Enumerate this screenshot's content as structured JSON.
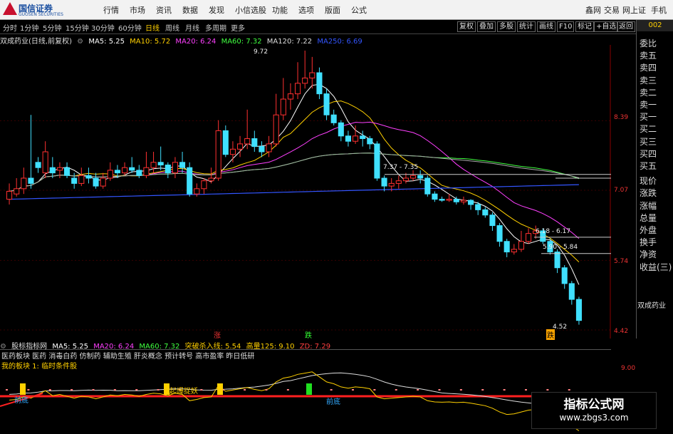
{
  "app": {
    "logo_text": "国信证券",
    "logo_sub": "GUOSEN SECURITIES",
    "menu": [
      "行情",
      "市场",
      "资讯",
      "数据",
      "发现",
      "小信选股",
      "功能",
      "选项",
      "版面",
      "公式"
    ],
    "menu_right": [
      "鑫网",
      "交易",
      "网上证",
      "手机"
    ]
  },
  "periods": [
    "分时",
    "1分钟",
    "5分钟",
    "15分钟",
    "30分钟",
    "60分钟",
    "日线",
    "周线",
    "月线",
    "多周期",
    "更多"
  ],
  "active_period": "日线",
  "toolbar_right": [
    "复权",
    "叠加",
    "多股",
    "统计",
    "画线",
    "F10",
    "标记",
    "+自选",
    "返回"
  ],
  "side_code": "002",
  "indicator_line": {
    "name": "双成药业(日线,前复权)",
    "ma5": "MA5: 5.25",
    "ma10": "MA10: 5.72",
    "ma20": "MA20: 6.24",
    "ma60": "MA60: 7.32",
    "ma120": "MA120: 7.22",
    "ma250": "MA250: 6.69"
  },
  "price_labels": [
    "8.39",
    "7.07",
    "5.74",
    "4.42"
  ],
  "annotations": {
    "high": "9.72",
    "range1": "7.37 - 7.35",
    "range2": "6.18 - 6.17",
    "range3": "5.90 - 5.84",
    "low": "4.52"
  },
  "markers": {
    "up": "涨",
    "down": "跌",
    "low_tag": "跌"
  },
  "side_panel": [
    "委比",
    "卖五",
    "卖四",
    "卖三",
    "卖二",
    "卖一",
    "买一",
    "买二",
    "买三",
    "买四",
    "买五",
    "现价",
    "涨跌",
    "涨幅",
    "总量",
    "外盘",
    "换手",
    "净资",
    "收益(三)"
  ],
  "stock_name": "双成药业",
  "lower_indicator": {
    "name": "股标指标网",
    "ma5": "MA5: 5.25",
    "ma20": "MA20: 6.24",
    "ma60": "MA60: 7.32",
    "break": "突破杀入线: 5.54",
    "vol": "高量125: 9.10",
    "zd": "ZD: 7.29"
  },
  "concept_line": "医药板块 医药 消毒白药 仿制药 辅助生殖 肝炎概念 预计转号 高市盈率 昨日低研",
  "concept_line2": "我的板块 1: 临时条件股",
  "lower_scale": "9.00",
  "lower_marks": {
    "bottom_left": "前底",
    "start": "起爆捉妖",
    "bottom_right": "前底"
  },
  "watermark": {
    "title": "指标公式网",
    "url": "www.zbgs3.com"
  },
  "chart_data": {
    "type": "candlestick",
    "title": "双成药业(日线,前复权)",
    "ylim": [
      4.42,
      9.72
    ],
    "y_ticks": [
      8.39,
      7.07,
      5.74,
      4.42
    ],
    "candles": [
      {
        "o": 6.9,
        "c": 7.05,
        "h": 7.2,
        "l": 6.8
      },
      {
        "o": 7.0,
        "c": 7.1,
        "h": 7.3,
        "l": 6.95
      },
      {
        "o": 7.1,
        "c": 7.3,
        "h": 7.5,
        "l": 7.0
      },
      {
        "o": 7.3,
        "c": 7.2,
        "h": 8.5,
        "l": 7.1
      },
      {
        "o": 7.6,
        "c": 7.5,
        "h": 7.7,
        "l": 7.4
      },
      {
        "o": 7.4,
        "c": 7.8,
        "h": 8.0,
        "l": 7.3
      },
      {
        "o": 7.5,
        "c": 7.4,
        "h": 7.7,
        "l": 7.3
      },
      {
        "o": 7.45,
        "c": 7.5,
        "h": 7.6,
        "l": 7.3
      },
      {
        "o": 7.5,
        "c": 7.35,
        "h": 7.6,
        "l": 7.3
      },
      {
        "o": 7.3,
        "c": 7.2,
        "h": 7.4,
        "l": 7.1
      },
      {
        "o": 7.2,
        "c": 7.35,
        "h": 7.5,
        "l": 7.15
      },
      {
        "o": 7.35,
        "c": 7.3,
        "h": 7.5,
        "l": 7.2
      },
      {
        "o": 7.3,
        "c": 7.15,
        "h": 7.4,
        "l": 7.1
      },
      {
        "o": 7.15,
        "c": 7.3,
        "h": 7.4,
        "l": 7.1
      },
      {
        "o": 7.3,
        "c": 7.45,
        "h": 7.6,
        "l": 7.25
      },
      {
        "o": 7.45,
        "c": 7.4,
        "h": 7.55,
        "l": 7.3
      },
      {
        "o": 7.4,
        "c": 7.5,
        "h": 7.6,
        "l": 7.35
      },
      {
        "o": 7.5,
        "c": 7.45,
        "h": 7.7,
        "l": 7.4
      },
      {
        "o": 7.45,
        "c": 7.35,
        "h": 7.55,
        "l": 7.3
      },
      {
        "o": 7.35,
        "c": 7.5,
        "h": 7.8,
        "l": 7.3
      },
      {
        "o": 7.5,
        "c": 7.6,
        "h": 7.8,
        "l": 7.4
      },
      {
        "o": 7.6,
        "c": 7.55,
        "h": 7.9,
        "l": 7.45
      },
      {
        "o": 7.55,
        "c": 7.4,
        "h": 7.6,
        "l": 7.3
      },
      {
        "o": 7.4,
        "c": 7.6,
        "h": 7.7,
        "l": 7.3
      },
      {
        "o": 7.6,
        "c": 7.5,
        "h": 7.8,
        "l": 7.4
      },
      {
        "o": 7.5,
        "c": 7.0,
        "h": 7.6,
        "l": 6.95
      },
      {
        "o": 7.0,
        "c": 7.1,
        "h": 7.2,
        "l": 6.95
      },
      {
        "o": 7.1,
        "c": 7.25,
        "h": 7.3,
        "l": 7.0
      },
      {
        "o": 7.25,
        "c": 7.3,
        "h": 7.5,
        "l": 7.2
      },
      {
        "o": 7.3,
        "c": 8.2,
        "h": 8.4,
        "l": 7.25
      },
      {
        "o": 8.2,
        "c": 7.75,
        "h": 8.3,
        "l": 7.7
      },
      {
        "o": 7.75,
        "c": 7.85,
        "h": 8.0,
        "l": 7.6
      },
      {
        "o": 7.85,
        "c": 7.95,
        "h": 8.1,
        "l": 7.7
      },
      {
        "o": 7.95,
        "c": 8.05,
        "h": 8.6,
        "l": 7.85
      },
      {
        "o": 8.05,
        "c": 7.9,
        "h": 8.2,
        "l": 7.8
      },
      {
        "o": 7.9,
        "c": 7.8,
        "h": 8.0,
        "l": 7.7
      },
      {
        "o": 7.8,
        "c": 7.95,
        "h": 8.1,
        "l": 7.7
      },
      {
        "o": 7.95,
        "c": 8.5,
        "h": 8.9,
        "l": 7.9
      },
      {
        "o": 8.5,
        "c": 8.8,
        "h": 9.2,
        "l": 8.4
      },
      {
        "o": 8.8,
        "c": 8.9,
        "h": 9.1,
        "l": 8.6
      },
      {
        "o": 8.9,
        "c": 9.1,
        "h": 9.5,
        "l": 8.8
      },
      {
        "o": 9.1,
        "c": 9.2,
        "h": 9.72,
        "l": 9.0
      },
      {
        "o": 9.2,
        "c": 9.3,
        "h": 9.6,
        "l": 9.0
      },
      {
        "o": 9.3,
        "c": 8.9,
        "h": 9.4,
        "l": 8.8
      },
      {
        "o": 8.9,
        "c": 8.5,
        "h": 9.0,
        "l": 8.4
      },
      {
        "o": 8.5,
        "c": 8.35,
        "h": 8.6,
        "l": 8.3
      },
      {
        "o": 8.35,
        "c": 8.1,
        "h": 8.4,
        "l": 8.0
      },
      {
        "o": 8.1,
        "c": 8.0,
        "h": 8.2,
        "l": 7.9
      },
      {
        "o": 8.0,
        "c": 8.1,
        "h": 8.3,
        "l": 7.95
      },
      {
        "o": 8.1,
        "c": 8.05,
        "h": 8.2,
        "l": 7.9
      },
      {
        "o": 8.05,
        "c": 7.95,
        "h": 8.1,
        "l": 7.85
      },
      {
        "o": 7.95,
        "c": 7.3,
        "h": 8.0,
        "l": 7.25
      },
      {
        "o": 7.3,
        "c": 7.15,
        "h": 7.35,
        "l": 7.05
      },
      {
        "o": 7.15,
        "c": 7.2,
        "h": 7.3,
        "l": 7.05
      },
      {
        "o": 7.2,
        "c": 7.25,
        "h": 7.35,
        "l": 7.1
      },
      {
        "o": 7.25,
        "c": 7.3,
        "h": 7.4,
        "l": 7.2
      },
      {
        "o": 7.3,
        "c": 7.35,
        "h": 7.45,
        "l": 7.25
      },
      {
        "o": 7.35,
        "c": 7.3,
        "h": 7.45,
        "l": 7.2
      },
      {
        "o": 7.3,
        "c": 7.0,
        "h": 7.35,
        "l": 6.95
      },
      {
        "o": 7.0,
        "c": 6.9,
        "h": 7.05,
        "l": 6.85
      },
      {
        "o": 6.9,
        "c": 6.88,
        "h": 6.95,
        "l": 6.85
      },
      {
        "o": 6.88,
        "c": 6.9,
        "h": 7.0,
        "l": 6.85
      },
      {
        "o": 6.9,
        "c": 6.85,
        "h": 6.95,
        "l": 6.8
      },
      {
        "o": 6.85,
        "c": 6.88,
        "h": 6.95,
        "l": 6.8
      },
      {
        "o": 6.88,
        "c": 6.8,
        "h": 6.9,
        "l": 6.7
      },
      {
        "o": 6.8,
        "c": 6.7,
        "h": 6.85,
        "l": 6.6
      },
      {
        "o": 6.7,
        "c": 6.6,
        "h": 6.75,
        "l": 6.55
      },
      {
        "o": 6.6,
        "c": 6.4,
        "h": 6.65,
        "l": 6.3
      },
      {
        "o": 6.4,
        "c": 6.1,
        "h": 6.45,
        "l": 6.0
      },
      {
        "o": 6.1,
        "c": 5.9,
        "h": 6.15,
        "l": 5.8
      },
      {
        "o": 5.9,
        "c": 5.95,
        "h": 6.05,
        "l": 5.85
      },
      {
        "o": 5.95,
        "c": 6.1,
        "h": 6.3,
        "l": 5.9
      },
      {
        "o": 6.1,
        "c": 6.25,
        "h": 6.35,
        "l": 6.05
      },
      {
        "o": 6.25,
        "c": 6.3,
        "h": 6.4,
        "l": 6.15
      },
      {
        "o": 6.3,
        "c": 6.1,
        "h": 6.35,
        "l": 6.05
      },
      {
        "o": 6.1,
        "c": 5.9,
        "h": 6.15,
        "l": 5.85
      },
      {
        "o": 5.9,
        "c": 5.6,
        "h": 5.95,
        "l": 5.5
      },
      {
        "o": 5.6,
        "c": 5.3,
        "h": 5.65,
        "l": 5.2
      },
      {
        "o": 5.3,
        "c": 5.0,
        "h": 5.35,
        "l": 4.9
      },
      {
        "o": 5.0,
        "c": 4.6,
        "h": 5.05,
        "l": 4.52
      }
    ]
  }
}
